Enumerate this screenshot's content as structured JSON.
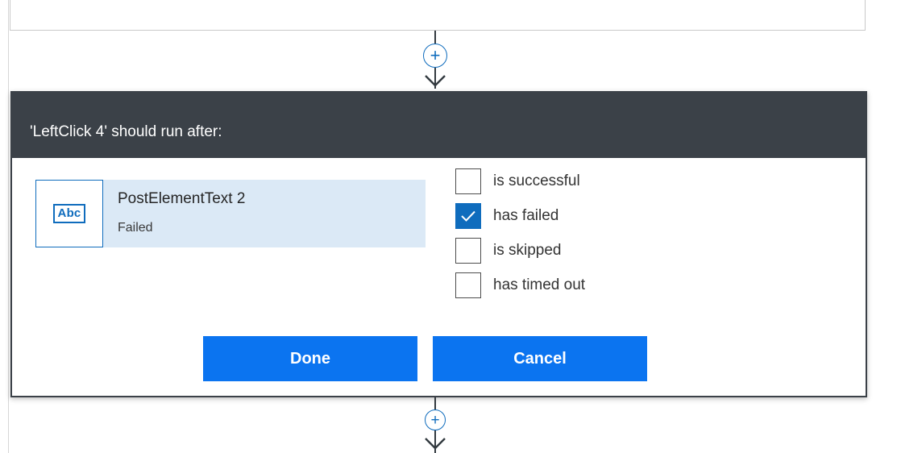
{
  "dialog": {
    "title": "'LeftClick 4' should run after:",
    "step": {
      "icon_text": "Abc",
      "name": "PostElementText 2",
      "status": "Failed"
    },
    "options": [
      {
        "label": "is successful",
        "checked": false
      },
      {
        "label": "has failed",
        "checked": true
      },
      {
        "label": "is skipped",
        "checked": false
      },
      {
        "label": "has timed out",
        "checked": false
      }
    ],
    "buttons": {
      "done_label": "Done",
      "cancel_label": "Cancel"
    }
  },
  "canvas": {
    "add_step_symbol": "+",
    "icons": [
      "plus-icon",
      "arrow-down-icon",
      "checkmark-icon",
      "abc-text-icon"
    ]
  },
  "colors": {
    "accent": "#0b74f0",
    "header_bg": "#3b4148",
    "selected_step_bg": "#dbe9f6",
    "icon_blue": "#0f6cbd"
  }
}
